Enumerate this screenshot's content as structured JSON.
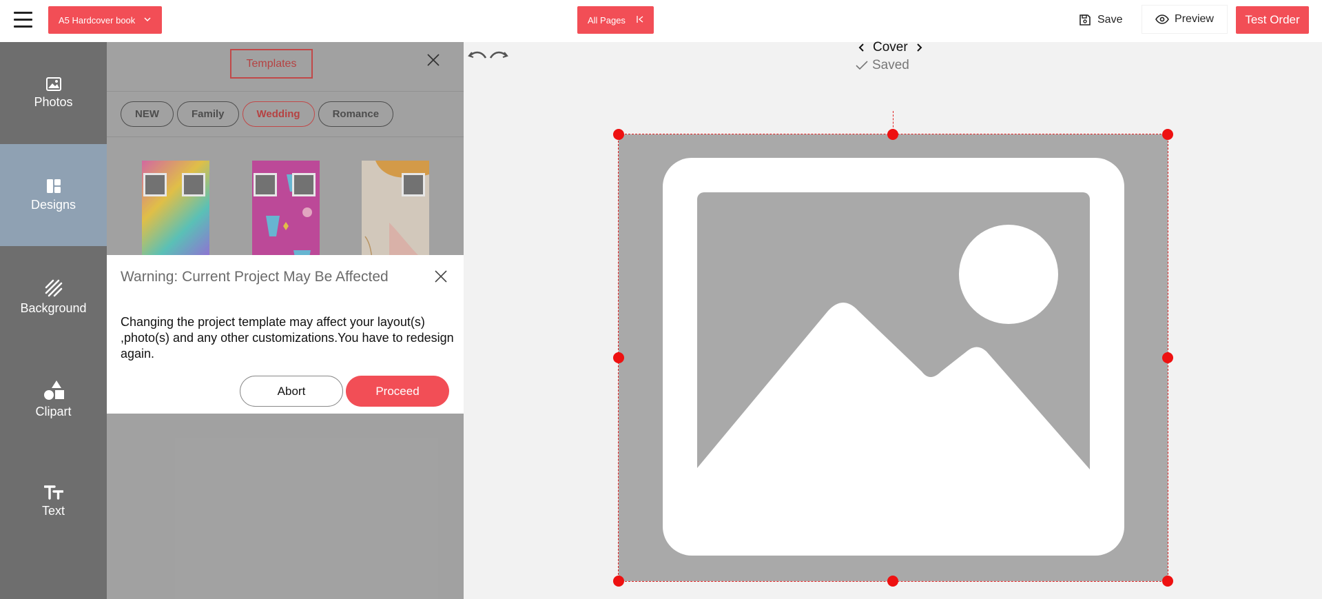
{
  "header": {
    "product_label": "A5 Hardcover book",
    "all_pages_label": "All Pages",
    "save_label": "Save",
    "preview_label": "Preview",
    "test_order_label": "Test Order"
  },
  "sidebar": {
    "items": [
      {
        "label": "Photos",
        "icon": "image-icon"
      },
      {
        "label": "Designs",
        "icon": "layout-icon"
      },
      {
        "label": "Background",
        "icon": "hatch-icon"
      },
      {
        "label": "Clipart",
        "icon": "shapes-icon"
      },
      {
        "label": "Text",
        "icon": "text-icon"
      }
    ],
    "active": "Designs"
  },
  "templates_panel": {
    "tab_label": "Templates",
    "chips": [
      "NEW",
      "Family",
      "Wedding",
      "Romance"
    ],
    "active_chip": "Wedding"
  },
  "dialog": {
    "title": "Warning: Current Project May Be Affected",
    "message": "Changing the project template may affect your layout(s) ,photo(s) and any other customizations.You have to redesign again.",
    "abort_label": "Abort",
    "proceed_label": "Proceed"
  },
  "canvas": {
    "page_name": "Cover",
    "status": "Saved"
  },
  "colors": {
    "accent": "#f24e56",
    "active_rail": "#8fa1b3",
    "rail": "#6e6e6e",
    "panel": "#b0b0b0",
    "selection": "#e02020"
  }
}
